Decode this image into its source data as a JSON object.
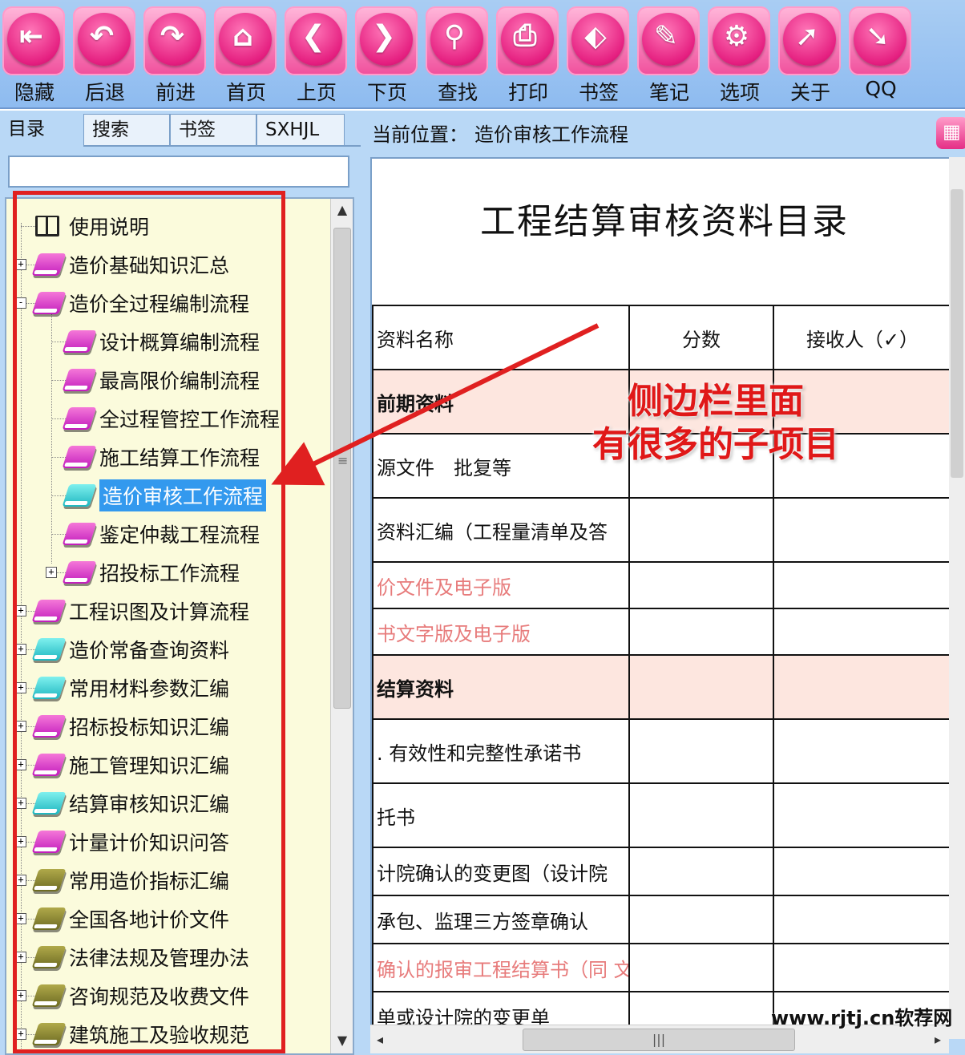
{
  "toolbar": {
    "buttons": [
      {
        "label": "隐藏",
        "icon": "hide-icon",
        "glyph": "⇤"
      },
      {
        "label": "后退",
        "icon": "back-icon",
        "glyph": "↶"
      },
      {
        "label": "前进",
        "icon": "forward-icon",
        "glyph": "↷"
      },
      {
        "label": "首页",
        "icon": "home-icon",
        "glyph": "⌂"
      },
      {
        "label": "上页",
        "icon": "previous-page-icon",
        "glyph": "❮"
      },
      {
        "label": "下页",
        "icon": "next-page-icon",
        "glyph": "❯"
      },
      {
        "label": "查找",
        "icon": "binoculars-icon",
        "glyph": "⚲"
      },
      {
        "label": "打印",
        "icon": "printer-icon",
        "glyph": "⎙"
      },
      {
        "label": "书签",
        "icon": "tag-icon",
        "glyph": "⬖"
      },
      {
        "label": "笔记",
        "icon": "note-icon",
        "glyph": "✎"
      },
      {
        "label": "选项",
        "icon": "gear-icon",
        "glyph": "⚙"
      },
      {
        "label": "关于",
        "icon": "pointer-icon",
        "glyph": "➚"
      },
      {
        "label": "QQ",
        "icon": "qq-icon",
        "glyph": "➘"
      }
    ],
    "accent": "#e51f80"
  },
  "left_panel": {
    "tabs": [
      "目录",
      "搜索",
      "书签",
      "SXHJL"
    ],
    "search_value": "",
    "tree": [
      {
        "label": "使用说明",
        "level": 0,
        "icon": "open-book-icon",
        "expander": ""
      },
      {
        "label": "造价基础知识汇总",
        "level": 0,
        "icon": "book-pink",
        "expander": "+"
      },
      {
        "label": "造价全过程编制流程",
        "level": 0,
        "icon": "book-pink",
        "expander": "-"
      },
      {
        "label": "设计概算编制流程",
        "level": 1,
        "icon": "book-pink",
        "expander": ""
      },
      {
        "label": "最高限价编制流程",
        "level": 1,
        "icon": "book-pink",
        "expander": ""
      },
      {
        "label": "全过程管控工作流程",
        "level": 1,
        "icon": "book-pink",
        "expander": ""
      },
      {
        "label": "施工结算工作流程",
        "level": 1,
        "icon": "book-pink",
        "expander": ""
      },
      {
        "label": "造价审核工作流程",
        "level": 1,
        "icon": "book-cyan",
        "expander": "",
        "selected": true
      },
      {
        "label": "鉴定仲裁工程流程",
        "level": 1,
        "icon": "book-pink",
        "expander": ""
      },
      {
        "label": "招投标工作流程",
        "level": 1,
        "icon": "book-pink",
        "expander": "+"
      },
      {
        "label": "工程识图及计算流程",
        "level": 0,
        "icon": "book-pink",
        "expander": "+"
      },
      {
        "label": "造价常备查询资料",
        "level": 0,
        "icon": "book-cyan",
        "expander": "+"
      },
      {
        "label": "常用材料参数汇编",
        "level": 0,
        "icon": "book-cyan",
        "expander": "+"
      },
      {
        "label": "招标投标知识汇编",
        "level": 0,
        "icon": "book-pink",
        "expander": "+"
      },
      {
        "label": "施工管理知识汇编",
        "level": 0,
        "icon": "book-pink",
        "expander": "+"
      },
      {
        "label": "结算审核知识汇编",
        "level": 0,
        "icon": "book-cyan",
        "expander": "+"
      },
      {
        "label": "计量计价知识问答",
        "level": 0,
        "icon": "book-pink",
        "expander": "+"
      },
      {
        "label": "常用造价指标汇编",
        "level": 0,
        "icon": "book-olive",
        "expander": "+"
      },
      {
        "label": "全国各地计价文件",
        "level": 0,
        "icon": "book-olive",
        "expander": "+"
      },
      {
        "label": "法律法规及管理办法",
        "level": 0,
        "icon": "book-olive",
        "expander": "+"
      },
      {
        "label": "咨询规范及收费文件",
        "level": 0,
        "icon": "book-olive",
        "expander": "+"
      },
      {
        "label": "建筑施工及验收规范",
        "level": 0,
        "icon": "book-olive",
        "expander": "+"
      }
    ]
  },
  "right_panel": {
    "location_prefix": "当前位置：",
    "location_value": "造价审核工作流程",
    "doc_title": "工程结算审核资料目录",
    "table_headers": [
      "资料名称",
      "分数",
      "接收人（✓）"
    ],
    "rows": [
      {
        "name": "前期资料",
        "type": "section",
        "height": 80
      },
      {
        "name": "源文件　批复等",
        "type": "normal",
        "height": 80
      },
      {
        "name": "资料汇编（工程量清单及答",
        "type": "normal",
        "height": 80
      },
      {
        "name": "价文件及电子版",
        "type": "red",
        "height": 58
      },
      {
        "name": "书文字版及电子版",
        "type": "red",
        "height": 58
      },
      {
        "name": "结算资料",
        "type": "section",
        "height": 80
      },
      {
        "name": ". 有效性和完整性承诺书",
        "type": "normal",
        "height": 80
      },
      {
        "name": "托书",
        "type": "normal",
        "height": 80
      },
      {
        "name": "计院确认的变更图（设计院",
        "type": "normal",
        "height": 60
      },
      {
        "name": "承包、监理三方签章确认",
        "type": "normal",
        "height": 60
      },
      {
        "name": "确认的报审工程结算书（同 文件版）",
        "type": "red",
        "height": 60
      },
      {
        "name": "单或设计院的变更单",
        "type": "normal",
        "height": 60
      }
    ]
  },
  "annotation": {
    "callout_line1": "侧边栏里面",
    "callout_line2": "有很多的子项目",
    "color": "#e02020"
  },
  "watermark": "www.rjtj.cn软荐网"
}
